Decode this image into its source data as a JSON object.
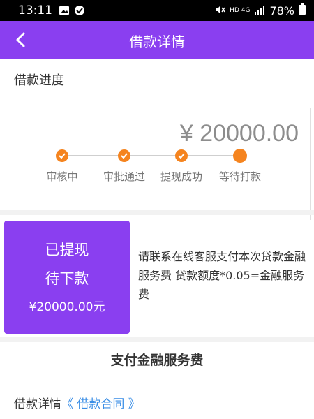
{
  "status_bar": {
    "time": "13:11",
    "network": "HD 4G",
    "battery": "78%"
  },
  "header": {
    "title": "借款详情"
  },
  "progress_section": {
    "title": "借款进度",
    "amount": "¥ 20000.00",
    "steps": [
      "审核中",
      "审批通过",
      "提现成功",
      "等待打款"
    ],
    "completed_steps": 3,
    "accent_color": "#f5841f"
  },
  "status_card": {
    "line1": "已提现",
    "line2": "待下款",
    "amount": "¥20000.00元",
    "color": "#8a3ff0"
  },
  "notice": {
    "text": "请联系在线客服支付本次贷款金融服务费 贷款额度*0.05=金融服务费"
  },
  "pay_button": {
    "label": "支付金融服务费"
  },
  "detail": {
    "label": "借款详情",
    "link": "《 借款合同 》"
  }
}
